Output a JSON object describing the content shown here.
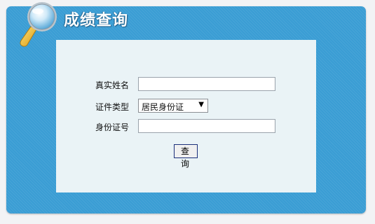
{
  "header": {
    "title": "成绩查询",
    "icon": "magnifier-icon"
  },
  "form": {
    "name_label": "真实姓名",
    "name_value": "",
    "id_type_label": "证件类型",
    "id_type_value": "居民身份证",
    "id_number_label": "身份证号",
    "id_number_value": "",
    "submit_label": "查 询"
  },
  "colors": {
    "panel": "#3a9dd4",
    "content_bg": "#eaf3f6",
    "button_border": "#1b2f7a"
  }
}
